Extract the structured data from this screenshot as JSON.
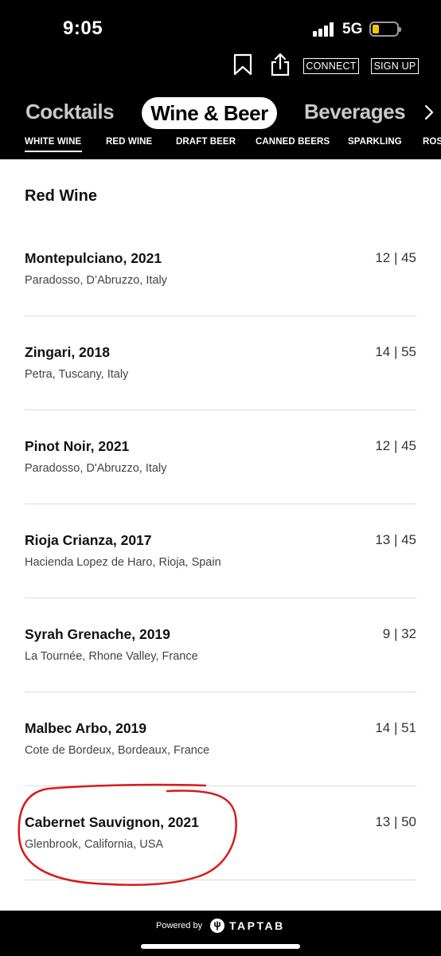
{
  "status": {
    "time": "9:05",
    "network": "5G"
  },
  "header": {
    "connect_label": "CONNECT",
    "signup_label": "SIGN UP",
    "categories": [
      "Cocktails",
      "Wine & Beer",
      "Beverages"
    ],
    "active_category": "Wine & Beer",
    "subtabs": [
      "WHITE WINE",
      "RED WINE",
      "DRAFT BEER",
      "CANNED BEERS",
      "SPARKLING",
      "ROS"
    ],
    "active_subtab": "WHITE WINE"
  },
  "section": {
    "title": "Red Wine"
  },
  "wines": [
    {
      "name": "Montepulciano, 2021",
      "origin": "Paradosso, D’Abruzzo, Italy",
      "price": "12 | 45"
    },
    {
      "name": "Zingari, 2018",
      "origin": "Petra, Tuscany, Italy",
      "price": "14 | 55"
    },
    {
      "name": "Pinot Noir, 2021",
      "origin": "Paradosso, D'Abruzzo, Italy",
      "price": "12 | 45"
    },
    {
      "name": "Rioja Crianza, 2017",
      "origin": "Hacienda Lopez de Haro, Rioja, Spain",
      "price": "13 | 45"
    },
    {
      "name": "Syrah Grenache, 2019",
      "origin": "La Tournée, Rhone Valley, France",
      "price": "9 | 32"
    },
    {
      "name": "Malbec Arbo, 2019",
      "origin": "Cote de Bordeux, Bordeaux, France",
      "price": "14 | 51"
    },
    {
      "name": "Cabernet Sauvignon, 2021",
      "origin": "Glenbrook, California, USA",
      "price": "13 | 50"
    }
  ],
  "footer": {
    "powered_by": "Powered by",
    "brand": "TAPTAB"
  },
  "colors": {
    "header_bg": "#000000",
    "highlight_circle": "#d81b1b",
    "battery_fill": "#f2c500"
  },
  "icons": [
    "bookmark-icon",
    "share-icon",
    "chevron-right-icon",
    "signal-icon",
    "battery-icon",
    "taptab-logo-icon"
  ]
}
